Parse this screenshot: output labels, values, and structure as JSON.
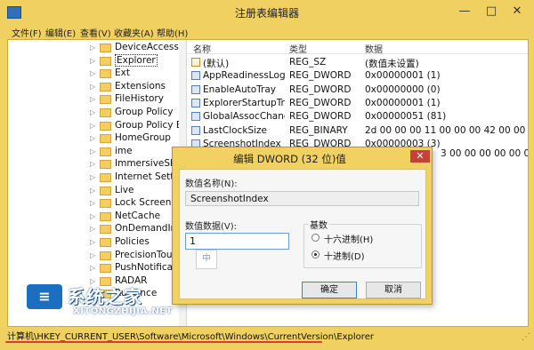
{
  "window": {
    "title": "注册表编辑器",
    "controls": {
      "minimize": "—",
      "maximize": "□",
      "close": "✕"
    }
  },
  "menubar": [
    {
      "label": "文件(F)"
    },
    {
      "label": "编辑(E)"
    },
    {
      "label": "查看(V)"
    },
    {
      "label": "收藏夹(A)"
    },
    {
      "label": "帮助(H)"
    }
  ],
  "tree": {
    "items": [
      {
        "label": "DeviceAccess"
      },
      {
        "label": "Explorer",
        "selected": true
      },
      {
        "label": "Ext"
      },
      {
        "label": "Extensions"
      },
      {
        "label": "FileHistory"
      },
      {
        "label": "Group Policy"
      },
      {
        "label": "Group Policy Edi"
      },
      {
        "label": "HomeGroup"
      },
      {
        "label": "ime"
      },
      {
        "label": "ImmersiveShell"
      },
      {
        "label": "Internet Settings"
      },
      {
        "label": "Live"
      },
      {
        "label": "Lock Screen"
      },
      {
        "label": "NetCache"
      },
      {
        "label": "OnDemandInter"
      },
      {
        "label": "Policies"
      },
      {
        "label": "PrecisionTouchP"
      },
      {
        "label": "PushNotification"
      },
      {
        "label": "RADAR"
      },
      {
        "label": "RunOnce"
      }
    ]
  },
  "list": {
    "headers": {
      "name": "名称",
      "type": "类型",
      "data": "数据"
    },
    "rows": [
      {
        "icon": "string-value-icon",
        "name": "(默认)",
        "type": "REG_SZ",
        "data": "(数值未设置)"
      },
      {
        "icon": "binary-value-icon",
        "name": "AppReadinessLogo...",
        "type": "REG_DWORD",
        "data": "0x00000001 (1)"
      },
      {
        "icon": "binary-value-icon",
        "name": "EnableAutoTray",
        "type": "REG_DWORD",
        "data": "0x00000000 (0)"
      },
      {
        "icon": "binary-value-icon",
        "name": "ExplorerStartupTra...",
        "type": "REG_DWORD",
        "data": "0x00000001 (1)"
      },
      {
        "icon": "binary-value-icon",
        "name": "GlobalAssocChang...",
        "type": "REG_DWORD",
        "data": "0x00000051 (81)"
      },
      {
        "icon": "binary-value-icon",
        "name": "LastClockSize",
        "type": "REG_BINARY",
        "data": "2d 00 00 00 11 00 00 00 42 00 00 00 11 0"
      },
      {
        "icon": "binary-value-icon",
        "name": "ScreenshotIndex",
        "type": "REG_DWORD",
        "data": "0x00000003 (3)"
      }
    ],
    "overflow_text": "3 00 00 00 00 00 00 00 00 00"
  },
  "dialog": {
    "title": "编辑 DWORD (32 位)值",
    "close": "✕",
    "name_label": "数值名称(N):",
    "name_value": "ScreenshotIndex",
    "data_label": "数值数据(V):",
    "data_value": "1",
    "ime_indicator": "中",
    "base_label": "基数",
    "radio_hex": "十六进制(H)",
    "radio_dec": "十进制(D)",
    "base_selected": "decimal",
    "ok": "确定",
    "cancel": "取消"
  },
  "status": {
    "path": "计算机\\HKEY_CURRENT_USER\\Software\\Microsoft\\Windows\\CurrentVersion\\Explorer"
  },
  "watermark": {
    "logo_glyph": "≡",
    "text": "系统之家",
    "sub": "XITONGZHIJIA.NET"
  },
  "colors": {
    "frame": "#f0d060",
    "accent_red": "#e23b2a",
    "close_button": "#c9403b",
    "watermark_blue": "#1b6fc0"
  }
}
